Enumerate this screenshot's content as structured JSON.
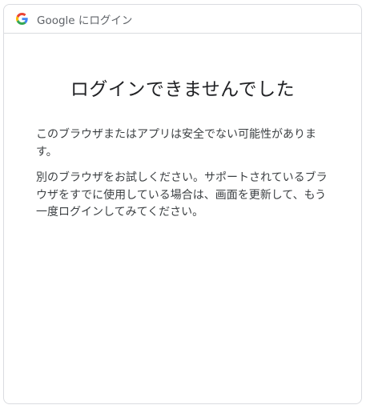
{
  "header": {
    "title": "Google にログイン",
    "logo_icon": "google-g-icon"
  },
  "main": {
    "title": "ログインできませんでした",
    "paragraph_1": "このブラウザまたはアプリは安全でない可能性があります。",
    "paragraph_2": "別のブラウザをお試しください。サポートされているブラウザをすでに使用している場合は、画面を更新して、もう一度ログインしてみてください。"
  },
  "colors": {
    "border": "#dadce0",
    "title_text": "#202124",
    "body_text": "#3c4043",
    "header_text": "#5f6368",
    "google_blue": "#4285F4",
    "google_red": "#EA4335",
    "google_yellow": "#FBBC05",
    "google_green": "#34A853"
  }
}
